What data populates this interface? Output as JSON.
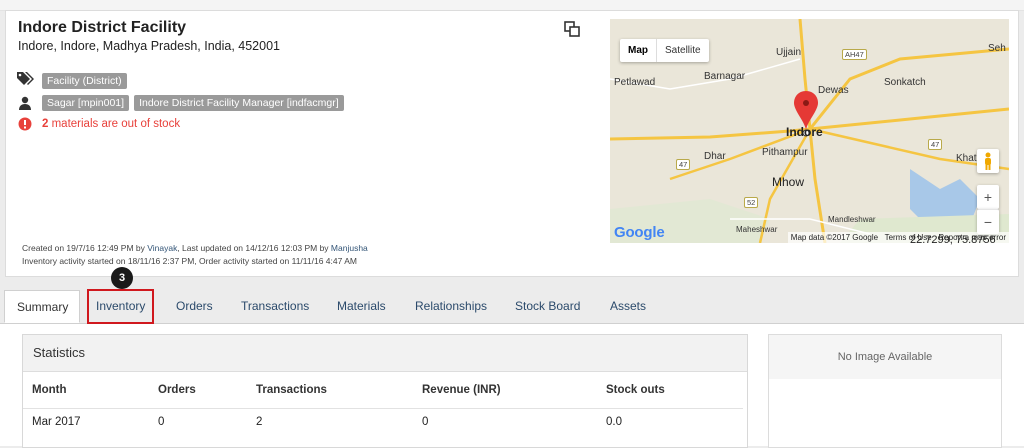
{
  "facility": {
    "name": "Indore District Facility",
    "address": "Indore, Indore, Madhya Pradesh, India, 452001",
    "tags": [
      "Facility (District)"
    ],
    "users": [
      "Sagar [mpin001]",
      "Indore District Facility Manager [indfacmgr]"
    ],
    "alert_count": "2",
    "alert_text": " materials are out of stock",
    "icons": [
      "tags-icon",
      "user-icon",
      "alert-icon",
      "copy-icon"
    ]
  },
  "meta": {
    "created_prefix": "Created on 19/7/16 12:49 PM by ",
    "created_by": "Vinayak",
    "updated_prefix": ", Last updated on 14/12/16 12:03 PM by ",
    "updated_by": "Manjusha",
    "activity": "Inventory activity started on 18/11/16 2:37 PM, Order activity started on 11/11/16 4:47 AM"
  },
  "map": {
    "map_btn": "Map",
    "satellite_btn": "Satellite",
    "places": [
      "Ujjain",
      "Barnagar",
      "Petlawad",
      "Dewas",
      "Sonkatch",
      "Indore",
      "Pithampur",
      "Dhar",
      "Mhow",
      "Khat",
      "Maheshwar",
      "Mandleshwar",
      "Seh"
    ],
    "highways": [
      "AH47",
      "47",
      "47",
      "52"
    ],
    "logo": "Google",
    "attribution": "Map data ©2017 Google",
    "terms": "Terms of Use",
    "report": "Report a map error",
    "zoom_in": "+",
    "zoom_out": "−",
    "coords": "22.7299, 75.8756"
  },
  "tabs": {
    "items": [
      "Summary",
      "Inventory",
      "Orders",
      "Transactions",
      "Materials",
      "Relationships",
      "Stock Board",
      "Assets"
    ],
    "active": "Summary",
    "step_badge": "3"
  },
  "statistics": {
    "title": "Statistics",
    "columns": [
      "Month",
      "Orders",
      "Transactions",
      "Revenue (INR)",
      "Stock outs"
    ],
    "rows": [
      [
        "Mar 2017",
        "0",
        "2",
        "0",
        "0.0"
      ]
    ]
  },
  "image_panel": {
    "text": "No Image Available"
  }
}
